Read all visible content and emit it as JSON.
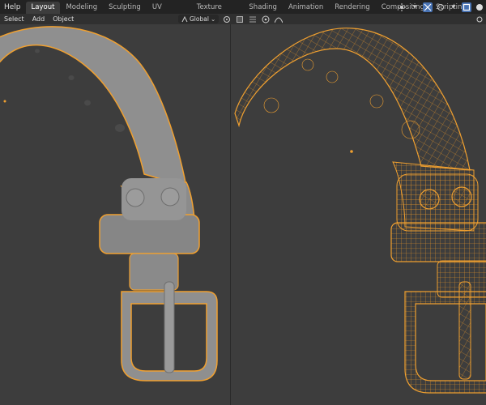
{
  "topbar": {
    "help_label": "Help",
    "tabs": [
      {
        "label": "Layout",
        "active": true
      },
      {
        "label": "Modeling"
      },
      {
        "label": "Sculpting"
      },
      {
        "label": "UV Editing"
      },
      {
        "label": "Texture Paint"
      },
      {
        "label": "Shading"
      },
      {
        "label": "Animation"
      },
      {
        "label": "Rendering"
      },
      {
        "label": "Compositing"
      },
      {
        "label": "Scripting"
      }
    ],
    "add_tab_label": "+",
    "icons": [
      "record-icon",
      "pivot-icon",
      "overlay-icon",
      "viewport-shading-icon"
    ]
  },
  "viewport_header": {
    "menus": [
      "Select",
      "Add",
      "Object"
    ],
    "transform_orientation": "Global",
    "icons": [
      "pivot-point-icon",
      "snap-icon",
      "proportional-edit-icon"
    ]
  },
  "colors": {
    "accent": "#4772b3",
    "selection": "#f0a030",
    "viewport_bg": "#3d3d3d",
    "mesh_solid": "#8c8c8c"
  }
}
